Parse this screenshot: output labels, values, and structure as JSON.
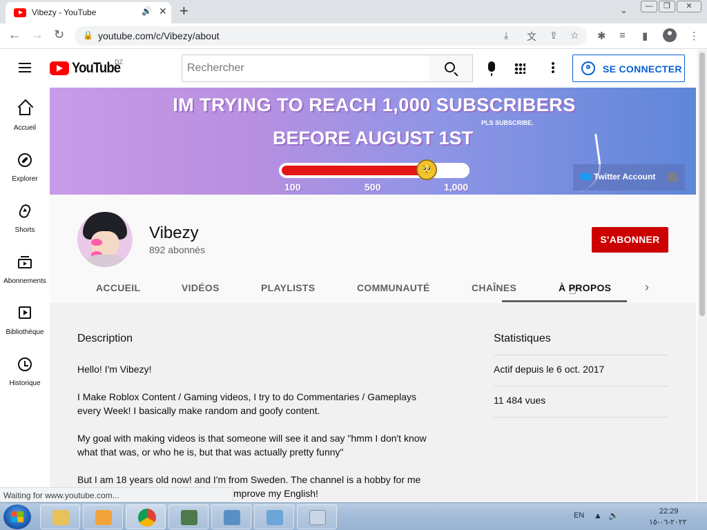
{
  "browser": {
    "tab_title": "Vibezy - YouTube",
    "url": "youtube.com/c/Vibezy/about",
    "window_controls": [
      "minimize",
      "restore",
      "close"
    ],
    "status_text": "Waiting for www.youtube.com..."
  },
  "youtube": {
    "logo_text": "YouTube",
    "country_code": "DZ",
    "search_placeholder": "Rechercher",
    "signin_label": "SE CONNECTER",
    "guide": [
      {
        "label": "Accueil",
        "icon": "home-icon"
      },
      {
        "label": "Explorer",
        "icon": "compass-icon"
      },
      {
        "label": "Shorts",
        "icon": "shorts-icon"
      },
      {
        "label": "Abonnements",
        "icon": "subscriptions-icon"
      },
      {
        "label": "Bibliothèque",
        "icon": "library-icon"
      },
      {
        "label": "Historique",
        "icon": "history-icon"
      }
    ],
    "colors": {
      "brand_red": "#ff0000",
      "subscribe_red": "#cc0000",
      "link_blue": "#065fd4"
    }
  },
  "banner": {
    "line1": "IM TRYING TO REACH 1,000 SUBSCRIBERS",
    "line2": "BEFORE AUGUST 1ST",
    "subtext": "PLS SUBSCRIBE.",
    "progress_fraction": 0.78,
    "tick_labels": [
      "100",
      "500",
      "1,000"
    ],
    "link_label": "Twitter Account"
  },
  "channel": {
    "name": "Vibezy",
    "subscribers": "892 abonnés",
    "subscribe_label": "S'ABONNER",
    "tabs": [
      "ACCUEIL",
      "VIDÉOS",
      "PLAYLISTS",
      "COMMUNAUTÉ",
      "CHAÎNES",
      "À PROPOS"
    ],
    "active_tab": "À PROPOS"
  },
  "about": {
    "description_title": "Description",
    "description_paragraphs": [
      "Hello! I'm Vibezy!",
      "I Make Roblox Content / Gaming videos, I try to do Commentaries / Gameplays every Week! I basically make random and goofy content.",
      "My goal with making videos is that someone will see it and say \"hmm I don't know what that was, or who he is, but that was actually pretty funny\"",
      "But I am 18 years old now! and I'm from Sweden. The channel is a hobby for me"
    ],
    "description_partial_line": "mprove my English!",
    "stats_title": "Statistiques",
    "stats": [
      "Actif depuis le 6 oct. 2017",
      "11 484 vues"
    ]
  },
  "taskbar": {
    "language": "EN",
    "time": "22:29",
    "date": "٢٠٢٢-٠٦-١٥"
  }
}
